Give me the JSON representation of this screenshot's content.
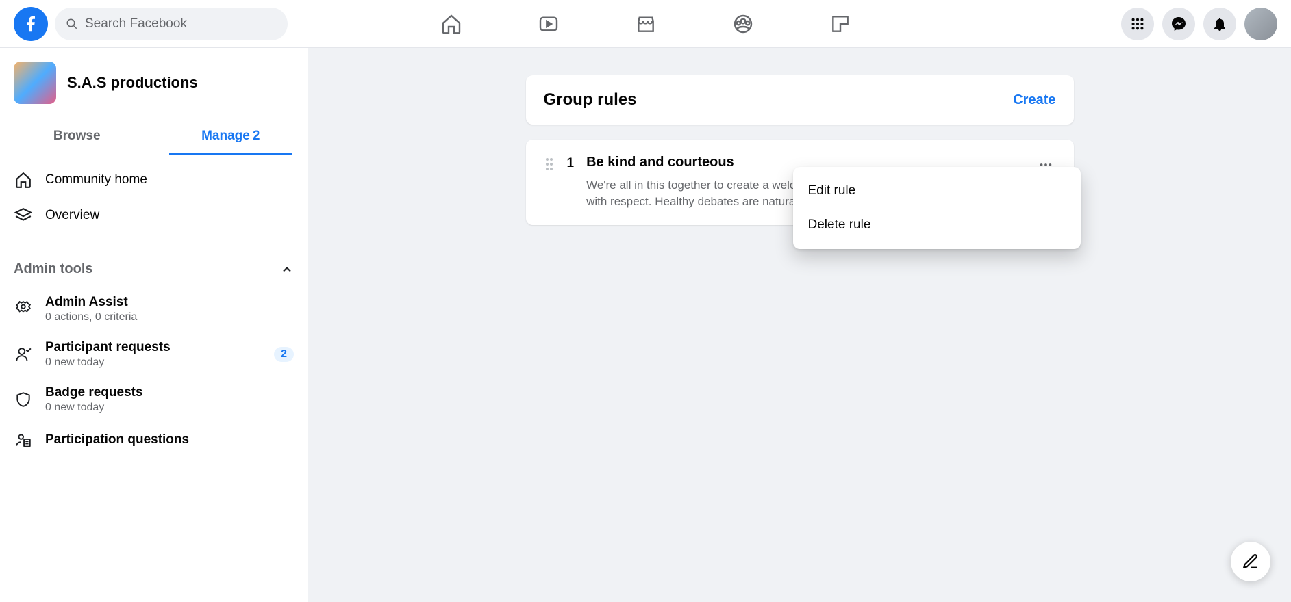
{
  "search": {
    "placeholder": "Search Facebook"
  },
  "group": {
    "name": "S.A.S productions"
  },
  "tabs": {
    "browse": "Browse",
    "manage": "Manage",
    "manage_count": "2"
  },
  "sidebar": {
    "community_home": "Community home",
    "overview": "Overview",
    "admin_tools_header": "Admin tools",
    "admin_assist": {
      "title": "Admin Assist",
      "sub": "0 actions, 0 criteria"
    },
    "participant_requests": {
      "title": "Participant requests",
      "sub": "0 new today",
      "badge": "2"
    },
    "badge_requests": {
      "title": "Badge requests",
      "sub": "0 new today"
    },
    "participation_questions": {
      "title": "Participation questions"
    }
  },
  "main": {
    "title": "Group rules",
    "create": "Create",
    "rule": {
      "number": "1",
      "title": "Be kind and courteous",
      "description": "We're all in this together to create a welcoming environment. Let's treat everyone with respect. Healthy debates are natural, but kindness is required."
    },
    "menu": {
      "edit": "Edit rule",
      "delete": "Delete rule"
    }
  }
}
